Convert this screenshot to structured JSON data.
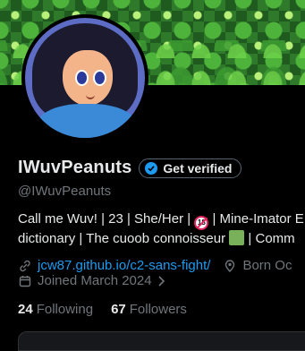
{
  "profile": {
    "display_name": "IWuvPeanuts",
    "verify_label": "Get verified",
    "handle": "@IWuvPeanuts",
    "bio": {
      "part1": "Call me Wuv! | 23 | She/Her | ",
      "age_badge": "18",
      "part2": " | Mine-Imator E",
      "line2a": "dictionary | The cuoob connoisseur ",
      "line2b": "  | Comm"
    },
    "website": "jcw87.github.io/c2-sans-fight/",
    "born": "Born Oc",
    "joined": "Joined March 2024",
    "following_count": "24",
    "following_label": "Following",
    "followers_count": "67",
    "followers_label": "Followers"
  },
  "colors": {
    "accent": "#1d9bf0",
    "background": "#000000",
    "secondary_text": "#71767b"
  },
  "icons": {
    "verified": "verified-badge-icon",
    "link": "link-icon",
    "location": "location-pin-icon",
    "calendar": "calendar-icon",
    "chevron": "chevron-right-icon"
  }
}
